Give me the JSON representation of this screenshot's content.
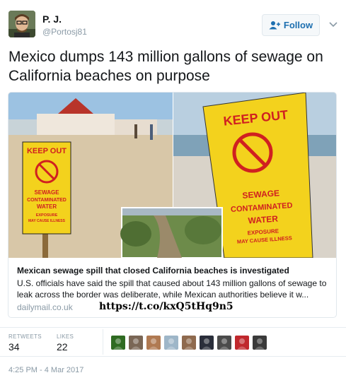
{
  "author": {
    "name": "P. J.",
    "handle": "@Portosj81"
  },
  "actions": {
    "follow_label": "Follow"
  },
  "tweet": {
    "text": "Mexico dumps 143 million gallons of sewage on California beaches on purpose",
    "timestamp": "4:25 PM - 4 Mar 2017"
  },
  "card": {
    "sign_lines_left": [
      "KEEP OUT",
      "SEWAGE",
      "CONTAMINATED",
      "WATER",
      "EXPOSURE",
      "MAY CAUSE ILLNESS"
    ],
    "sign_lines_right": [
      "KEEP OUT",
      "SEWAGE",
      "CONTAMINATED",
      "WATER",
      "EXPOSURE",
      "MAY CAUSE ILLNESS"
    ],
    "title": "Mexican sewage spill that closed California beaches is investigated",
    "description": "U.S. officials have said the spill that caused about 143 million gallons of sewage to leak across the border was deliberate, while Mexican authorities believe it w...",
    "domain": "dailymail.co.uk",
    "short_link": "https://t.co/kxQ5tHq9n5"
  },
  "stats": {
    "retweets_label": "RETWEETS",
    "retweets_count": "34",
    "likes_label": "LIKES",
    "likes_count": "22"
  },
  "likers": [
    {
      "icon": "green-alien-avatar",
      "color": "#2f6b22"
    },
    {
      "icon": "crowd-avatar",
      "color": "#7a6655"
    },
    {
      "icon": "woman-avatar",
      "color": "#b07a52"
    },
    {
      "icon": "beach-avatar",
      "color": "#9eb6c8"
    },
    {
      "icon": "man-avatar",
      "color": "#8f6a4e"
    },
    {
      "icon": "skull-avatar",
      "color": "#2a2e3a"
    },
    {
      "icon": "hat-man-avatar",
      "color": "#4b4b4b"
    },
    {
      "icon": "red-logo-avatar",
      "color": "#c0282d"
    },
    {
      "icon": "dark-avatar",
      "color": "#3a3a3a"
    }
  ],
  "colors": {
    "link_blue": "#1d6fb0",
    "muted_gray": "#8a9aa6",
    "sign_yellow": "#f3d21d",
    "sign_red": "#d02020"
  }
}
